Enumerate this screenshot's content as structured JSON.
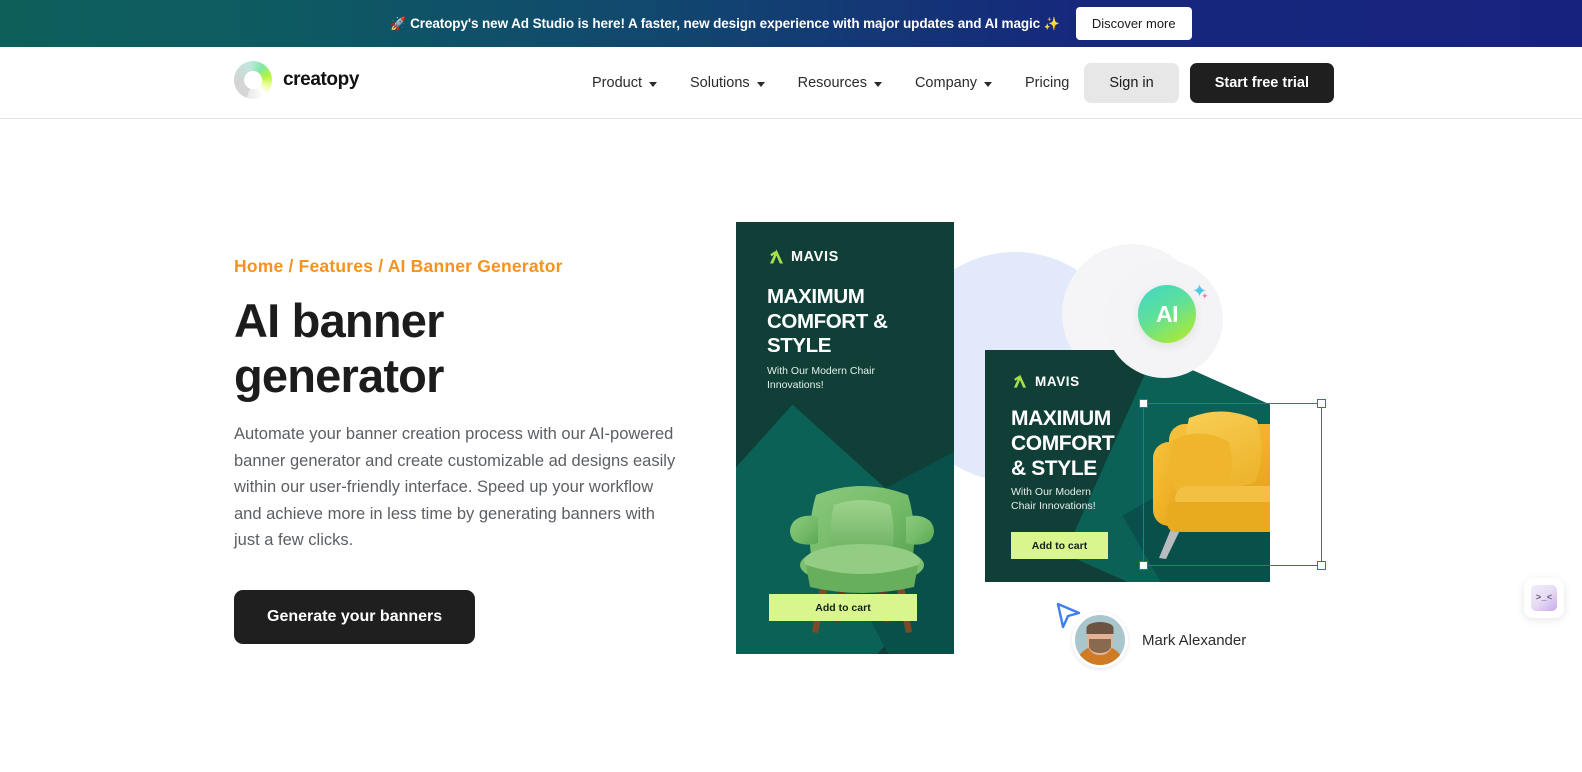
{
  "promo": {
    "rocket_icon": "🚀",
    "text": "Creatopy's new Ad Studio is here! A faster, new design experience with major updates and AI magic",
    "sparkle_icon": "✨",
    "button_label": "Discover more",
    "gradient_from": "#0d5f5a",
    "gradient_to": "#17227e"
  },
  "header": {
    "logo_text": "creatopy",
    "nav_items": [
      {
        "label": "Product",
        "has_dropdown": true
      },
      {
        "label": "Solutions",
        "has_dropdown": true
      },
      {
        "label": "Resources",
        "has_dropdown": true
      },
      {
        "label": "Company",
        "has_dropdown": true
      },
      {
        "label": "Pricing",
        "has_dropdown": false
      }
    ],
    "sign_in_label": "Sign in",
    "start_trial_label": "Start free trial"
  },
  "hero": {
    "breadcrumb": {
      "home": "Home",
      "sep1": " / ",
      "features": "Features",
      "sep2": " / ",
      "current": "AI Banner Generator",
      "color": "#f6921e"
    },
    "title_line1": "AI banner",
    "title_line2": "generator",
    "paragraph": "Automate your banner creation process with our AI-powered banner generator and create customizable ad designs easily within our user-friendly interface. Speed up your workflow and achieve more in less time by generating banners with just a few clicks.",
    "cta_label": "Generate your banners"
  },
  "visual": {
    "banner_vertical": {
      "brand": "MAVIS",
      "headline_line1": "MAXIMUM",
      "headline_line2": "COMFORT &",
      "headline_line3": "STYLE",
      "subtext_line1": "With Our Modern Chair",
      "subtext_line2": "Innovations!",
      "cta_label": "Add to cart",
      "bg_color": "#103f37",
      "cta_color": "#d9f58e",
      "product": "green-armchair"
    },
    "banner_horizontal": {
      "brand": "MAVIS",
      "headline_line1": "MAXIMUM",
      "headline_line2": "COMFORT",
      "headline_line3": "& STYLE",
      "subtext_line1": "With Our Modern",
      "subtext_line2": "Chair Innovations!",
      "cta_label": "Add to cart",
      "bg_color": "#103f37",
      "cta_color": "#d9f58e",
      "product": "yellow-armchair"
    },
    "ai_badge": {
      "label": "AI",
      "gradient_from": "#3fd6c8",
      "gradient_to": "#b5ed39"
    },
    "collaborator": {
      "name": "Mark Alexander",
      "cursor_color": "#3d7ff0"
    },
    "selection_color": "#1a6ef5"
  },
  "widget": {
    "face": "&gt;_&lt;"
  }
}
